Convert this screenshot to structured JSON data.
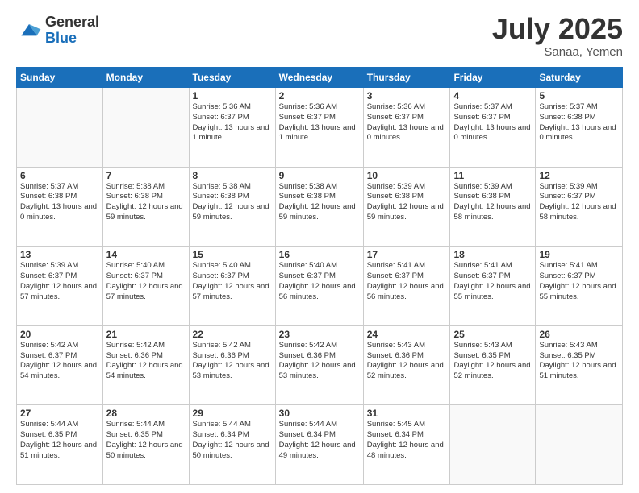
{
  "logo": {
    "general": "General",
    "blue": "Blue"
  },
  "title": "July 2025",
  "location": "Sanaa, Yemen",
  "days_of_week": [
    "Sunday",
    "Monday",
    "Tuesday",
    "Wednesday",
    "Thursday",
    "Friday",
    "Saturday"
  ],
  "weeks": [
    [
      {
        "day": "",
        "info": ""
      },
      {
        "day": "",
        "info": ""
      },
      {
        "day": "1",
        "info": "Sunrise: 5:36 AM\nSunset: 6:37 PM\nDaylight: 13 hours and 1 minute."
      },
      {
        "day": "2",
        "info": "Sunrise: 5:36 AM\nSunset: 6:37 PM\nDaylight: 13 hours and 1 minute."
      },
      {
        "day": "3",
        "info": "Sunrise: 5:36 AM\nSunset: 6:37 PM\nDaylight: 13 hours and 0 minutes."
      },
      {
        "day": "4",
        "info": "Sunrise: 5:37 AM\nSunset: 6:37 PM\nDaylight: 13 hours and 0 minutes."
      },
      {
        "day": "5",
        "info": "Sunrise: 5:37 AM\nSunset: 6:38 PM\nDaylight: 13 hours and 0 minutes."
      }
    ],
    [
      {
        "day": "6",
        "info": "Sunrise: 5:37 AM\nSunset: 6:38 PM\nDaylight: 13 hours and 0 minutes."
      },
      {
        "day": "7",
        "info": "Sunrise: 5:38 AM\nSunset: 6:38 PM\nDaylight: 12 hours and 59 minutes."
      },
      {
        "day": "8",
        "info": "Sunrise: 5:38 AM\nSunset: 6:38 PM\nDaylight: 12 hours and 59 minutes."
      },
      {
        "day": "9",
        "info": "Sunrise: 5:38 AM\nSunset: 6:38 PM\nDaylight: 12 hours and 59 minutes."
      },
      {
        "day": "10",
        "info": "Sunrise: 5:39 AM\nSunset: 6:38 PM\nDaylight: 12 hours and 59 minutes."
      },
      {
        "day": "11",
        "info": "Sunrise: 5:39 AM\nSunset: 6:38 PM\nDaylight: 12 hours and 58 minutes."
      },
      {
        "day": "12",
        "info": "Sunrise: 5:39 AM\nSunset: 6:37 PM\nDaylight: 12 hours and 58 minutes."
      }
    ],
    [
      {
        "day": "13",
        "info": "Sunrise: 5:39 AM\nSunset: 6:37 PM\nDaylight: 12 hours and 57 minutes."
      },
      {
        "day": "14",
        "info": "Sunrise: 5:40 AM\nSunset: 6:37 PM\nDaylight: 12 hours and 57 minutes."
      },
      {
        "day": "15",
        "info": "Sunrise: 5:40 AM\nSunset: 6:37 PM\nDaylight: 12 hours and 57 minutes."
      },
      {
        "day": "16",
        "info": "Sunrise: 5:40 AM\nSunset: 6:37 PM\nDaylight: 12 hours and 56 minutes."
      },
      {
        "day": "17",
        "info": "Sunrise: 5:41 AM\nSunset: 6:37 PM\nDaylight: 12 hours and 56 minutes."
      },
      {
        "day": "18",
        "info": "Sunrise: 5:41 AM\nSunset: 6:37 PM\nDaylight: 12 hours and 55 minutes."
      },
      {
        "day": "19",
        "info": "Sunrise: 5:41 AM\nSunset: 6:37 PM\nDaylight: 12 hours and 55 minutes."
      }
    ],
    [
      {
        "day": "20",
        "info": "Sunrise: 5:42 AM\nSunset: 6:37 PM\nDaylight: 12 hours and 54 minutes."
      },
      {
        "day": "21",
        "info": "Sunrise: 5:42 AM\nSunset: 6:36 PM\nDaylight: 12 hours and 54 minutes."
      },
      {
        "day": "22",
        "info": "Sunrise: 5:42 AM\nSunset: 6:36 PM\nDaylight: 12 hours and 53 minutes."
      },
      {
        "day": "23",
        "info": "Sunrise: 5:42 AM\nSunset: 6:36 PM\nDaylight: 12 hours and 53 minutes."
      },
      {
        "day": "24",
        "info": "Sunrise: 5:43 AM\nSunset: 6:36 PM\nDaylight: 12 hours and 52 minutes."
      },
      {
        "day": "25",
        "info": "Sunrise: 5:43 AM\nSunset: 6:35 PM\nDaylight: 12 hours and 52 minutes."
      },
      {
        "day": "26",
        "info": "Sunrise: 5:43 AM\nSunset: 6:35 PM\nDaylight: 12 hours and 51 minutes."
      }
    ],
    [
      {
        "day": "27",
        "info": "Sunrise: 5:44 AM\nSunset: 6:35 PM\nDaylight: 12 hours and 51 minutes."
      },
      {
        "day": "28",
        "info": "Sunrise: 5:44 AM\nSunset: 6:35 PM\nDaylight: 12 hours and 50 minutes."
      },
      {
        "day": "29",
        "info": "Sunrise: 5:44 AM\nSunset: 6:34 PM\nDaylight: 12 hours and 50 minutes."
      },
      {
        "day": "30",
        "info": "Sunrise: 5:44 AM\nSunset: 6:34 PM\nDaylight: 12 hours and 49 minutes."
      },
      {
        "day": "31",
        "info": "Sunrise: 5:45 AM\nSunset: 6:34 PM\nDaylight: 12 hours and 48 minutes."
      },
      {
        "day": "",
        "info": ""
      },
      {
        "day": "",
        "info": ""
      }
    ]
  ]
}
